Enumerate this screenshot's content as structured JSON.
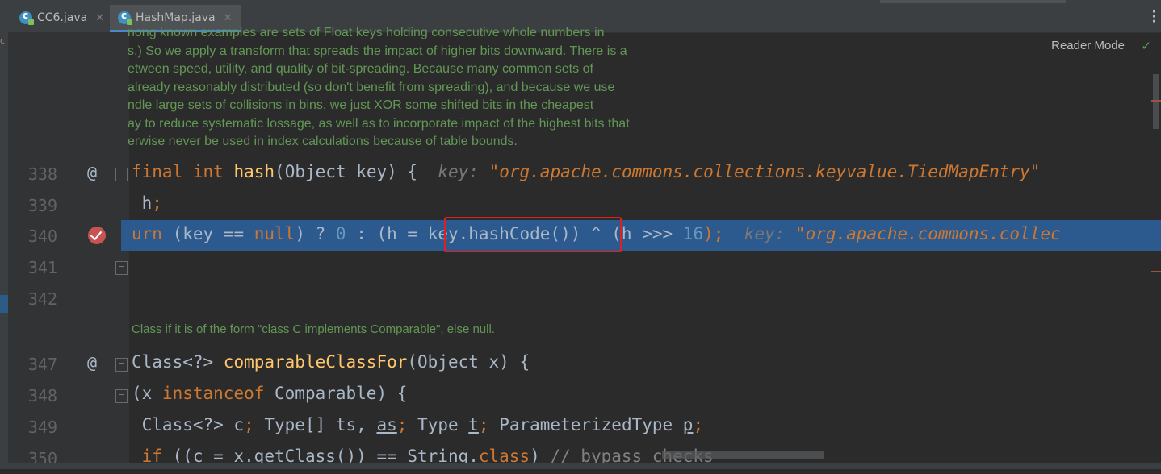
{
  "tabs": [
    {
      "label": "CC6.java",
      "active": false
    },
    {
      "label": "HashMap.java",
      "active": true
    }
  ],
  "reader_mode_label": "Reader Mode",
  "doc_lines": [
    "nong known examples are sets of Float keys holding consecutive whole numbers in",
    "s.) So we apply a transform that spreads the impact of higher bits downward. There is a",
    "etween speed, utility, and quality of bit-spreading. Because many common sets of",
    " already reasonably distributed (so don't benefit from spreading), and because we use",
    "ndle large sets of collisions in bins, we just XOR some shifted bits in the cheapest",
    "ay to reduce systematic lossage, as well as to incorporate impact of the highest bits that",
    "erwise never be used in index calculations because of table bounds."
  ],
  "doc2": "Class if it is of the form \"class C implements Comparable\", else null.",
  "line_numbers": {
    "l338": "338",
    "l339": "339",
    "l340": "340",
    "l341": "341",
    "l342": "342",
    "l347": "347",
    "l348": "348",
    "l349": "349",
    "l350": "350"
  },
  "code": {
    "l338": {
      "kw1": "final",
      "kw2": "int",
      "fn": "hash",
      "rest": "(Object key) {",
      "hint_key": "key:",
      "hint_val": "\"org.apache.commons.collections.keyvalue.TiedMapEntry\""
    },
    "l339": {
      "text": " h",
      "semi": ";"
    },
    "l340": {
      "kw1": "urn",
      "p1": " (key == ",
      "kw2": "null",
      "p2": ") ? ",
      "n1": "0",
      "p3": " : (h = ",
      "call": "key.hashCode()",
      "p4": ") ^ (h >>> ",
      "n2": "16",
      "p5": ");",
      "hint_key": "key:",
      "hint_val": "\"org.apache.commons.collec"
    },
    "l347": {
      "t1": "Class<?> ",
      "fn": "comparableClassFor",
      "rest": "(Object x) {"
    },
    "l348": {
      "t1": "(x ",
      "kw": "instanceof",
      "rest": " Comparable) {"
    },
    "l349": {
      "t1": " Class<?> c",
      "s1": ";",
      "t2": " Type[] ts, ",
      "as": "as",
      "s2": ";",
      "t3": " Type ",
      "tvar": "t",
      "s3": ";",
      "t4": " ParameterizedType ",
      "pvar": "p",
      "s4": ";"
    },
    "l350": {
      "kw": " if",
      "t1": " ((c = x.getClass()) == String.",
      "kw2": "class",
      "t2": ") ",
      "cmt": "// bypass checks"
    }
  },
  "colors": {
    "keyword": "#cc7832",
    "function": "#ffc66d",
    "number": "#6897bb",
    "exec_line": "#2d5a8e",
    "highlight_box": "#e02020"
  },
  "icons": [
    "c-class-icon",
    "close-icon",
    "more-menu-icon",
    "checkmark-icon",
    "breakpoint-icon",
    "fold-icon",
    "override-at-icon"
  ]
}
